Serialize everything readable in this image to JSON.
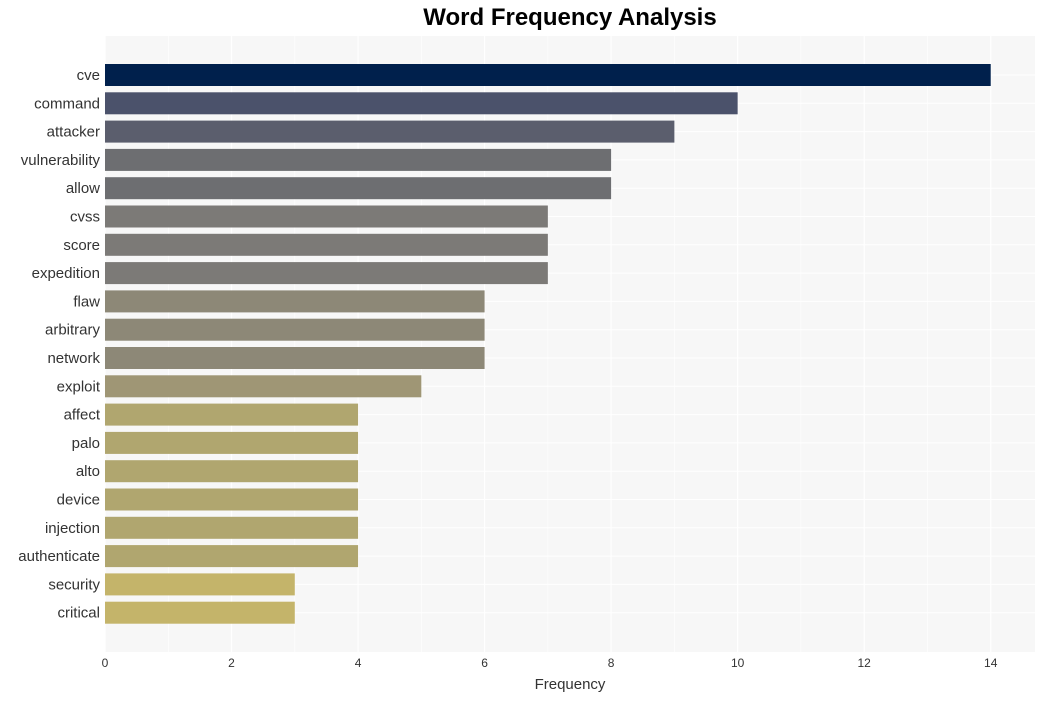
{
  "chart_data": {
    "type": "bar",
    "orientation": "horizontal",
    "title": "Word Frequency Analysis",
    "xlabel": "Frequency",
    "ylabel": "",
    "xlim": [
      0,
      14.7
    ],
    "xticks": [
      0,
      2,
      4,
      6,
      8,
      10,
      12,
      14
    ],
    "grid": true,
    "categories": [
      "cve",
      "command",
      "attacker",
      "vulnerability",
      "allow",
      "cvss",
      "score",
      "expedition",
      "flaw",
      "arbitrary",
      "network",
      "exploit",
      "affect",
      "palo",
      "alto",
      "device",
      "injection",
      "authenticate",
      "security",
      "critical"
    ],
    "values": [
      14,
      10,
      9,
      8,
      8,
      7,
      7,
      7,
      6,
      6,
      6,
      5,
      4,
      4,
      4,
      4,
      4,
      4,
      3,
      3
    ],
    "colors": [
      "#00204c",
      "#4b526b",
      "#5b5e6d",
      "#6d6e71",
      "#6d6e71",
      "#7c7a77",
      "#7c7a77",
      "#7c7a77",
      "#8d8877",
      "#8d8877",
      "#8d8877",
      "#9f9675",
      "#b0a66f",
      "#b0a66f",
      "#b0a66f",
      "#b0a66f",
      "#b0a66f",
      "#b0a66f",
      "#c4b46a",
      "#c4b46a"
    ]
  }
}
